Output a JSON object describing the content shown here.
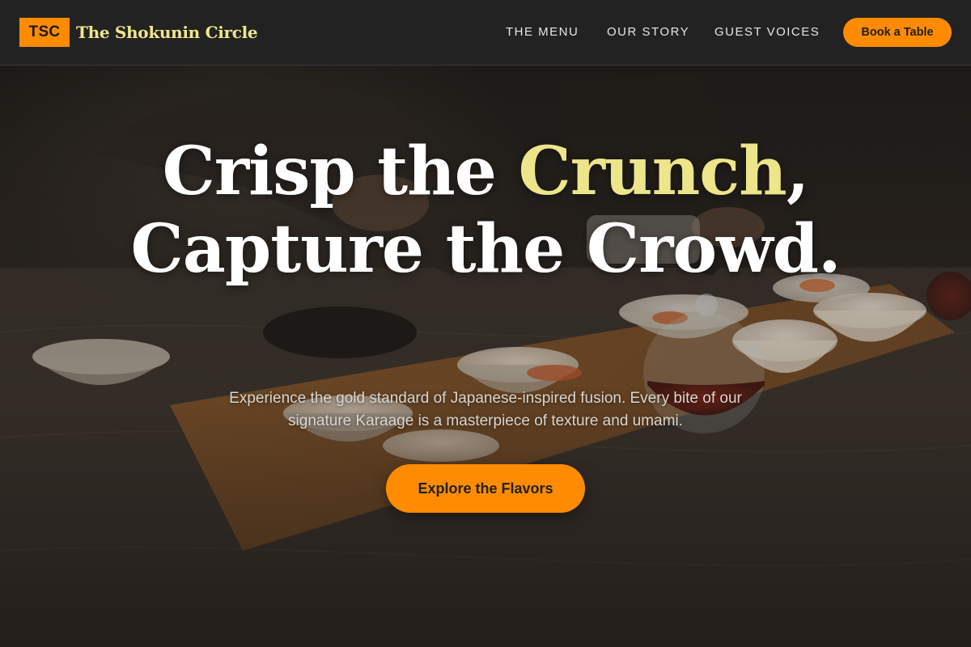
{
  "header": {
    "logo_badge": "TSC",
    "brand_name": "The Shokunin Circle",
    "nav": [
      {
        "label": "THE MENU"
      },
      {
        "label": "OUR STORY"
      },
      {
        "label": "GUEST VOICES"
      }
    ],
    "book_label": "Book a Table"
  },
  "hero": {
    "headline_part1": "Crisp the ",
    "headline_accent": "Crunch",
    "headline_part2": ", Capture the Crowd.",
    "subtext": "Experience the gold standard of Japanese-inspired fusion. Every bite of our signature Karaage is a masterpiece of texture and umami.",
    "cta_label": "Explore the Flavors"
  },
  "colors": {
    "accent_orange": "#ff8c00",
    "accent_gold": "#ede58a",
    "header_bg": "#222222",
    "brand_text": "#f0e68c"
  }
}
